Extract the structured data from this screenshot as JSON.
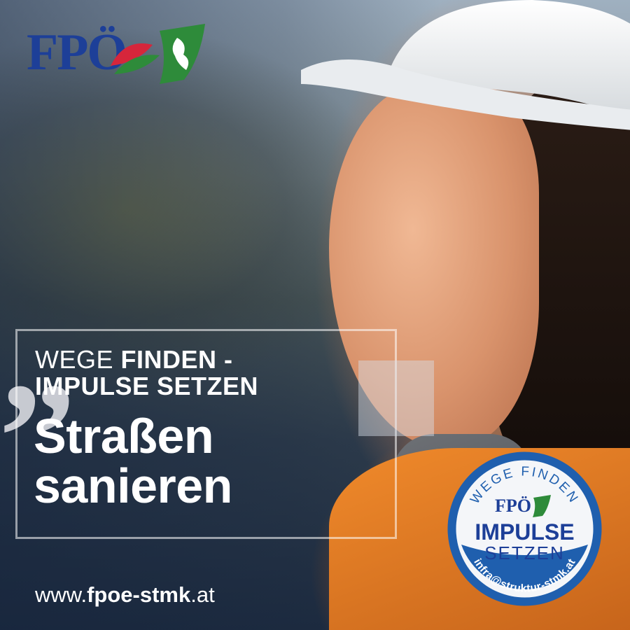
{
  "logo": {
    "text": "FPÖ"
  },
  "slogan": {
    "line1_light": "WEGE ",
    "line1_bold": "FINDEN -",
    "line2_bold": "IMPULSE SETZEN"
  },
  "headline": {
    "line1": "Straßen",
    "line2": "sanieren"
  },
  "website": {
    "prefix": "www.",
    "bold": "fpoe-stmk",
    "suffix": ".at"
  },
  "badge": {
    "arc_text": "WEGE FINDEN",
    "logo_text": "FPÖ",
    "line1": "IMPULSE",
    "line2": "SETZEN",
    "email": "infra@struktur-stmk.at"
  },
  "colors": {
    "brand_blue": "#1d3f98",
    "badge_blue": "#1f5fae",
    "accent_orange": "#e8782a"
  }
}
